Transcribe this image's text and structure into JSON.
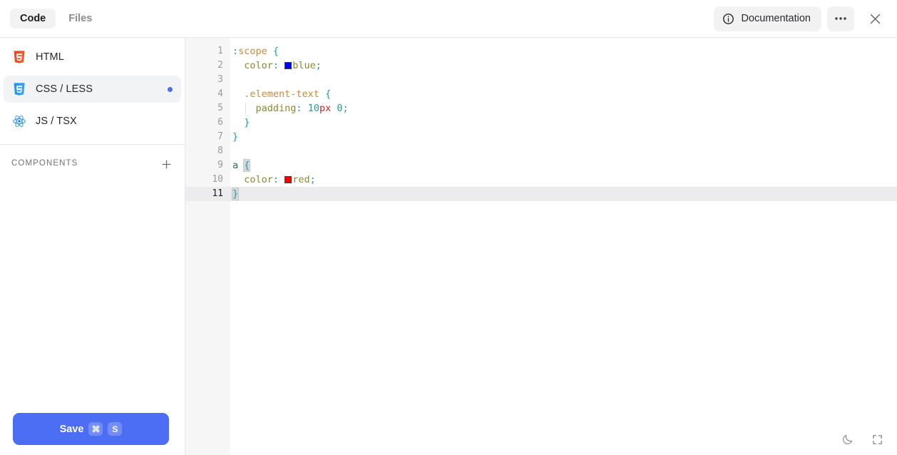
{
  "topbar": {
    "tabs": [
      {
        "label": "Code",
        "active": true
      },
      {
        "label": "Files",
        "active": false
      }
    ],
    "documentation_label": "Documentation",
    "info_icon": "info-circle-icon",
    "more_icon": "ellipsis-icon",
    "close_icon": "close-icon"
  },
  "sidebar": {
    "files": [
      {
        "label": "HTML",
        "icon": "html5-icon",
        "active": false,
        "modified": false
      },
      {
        "label": "CSS / LESS",
        "icon": "css3-icon",
        "active": true,
        "modified": true
      },
      {
        "label": "JS / TSX",
        "icon": "react-icon",
        "active": false,
        "modified": false
      }
    ],
    "components_title": "COMPONENTS",
    "add_icon": "plus-icon",
    "save": {
      "label": "Save",
      "shortcut_modifier": "⌘",
      "shortcut_key": "S"
    }
  },
  "editor": {
    "language": "css",
    "active_line": 11,
    "lines": [
      {
        "n": "1",
        "tokens": [
          {
            "t": ":",
            "c": "t-punct"
          },
          {
            "t": "scope",
            "c": "t-sel"
          },
          {
            "t": " ",
            "c": ""
          },
          {
            "t": "{",
            "c": "t-punct"
          }
        ]
      },
      {
        "n": "2",
        "indent": 0,
        "tokens": [
          {
            "t": "  ",
            "c": ""
          },
          {
            "t": "color",
            "c": "t-prop"
          },
          {
            "t": ":",
            "c": "t-punct"
          },
          {
            "t": " ",
            "c": ""
          },
          {
            "t": "#0000ff",
            "c": "swatch"
          },
          {
            "t": "blue",
            "c": "t-val"
          },
          {
            "t": ";",
            "c": "t-semi"
          }
        ]
      },
      {
        "n": "3",
        "tokens": []
      },
      {
        "n": "4",
        "tokens": [
          {
            "t": "  ",
            "c": ""
          },
          {
            "t": ".element-text",
            "c": "t-sel"
          },
          {
            "t": " ",
            "c": ""
          },
          {
            "t": "{",
            "c": "t-punct"
          }
        ]
      },
      {
        "n": "5",
        "guide": 21,
        "tokens": [
          {
            "t": "    ",
            "c": ""
          },
          {
            "t": "padding",
            "c": "t-prop"
          },
          {
            "t": ":",
            "c": "t-punct"
          },
          {
            "t": " ",
            "c": ""
          },
          {
            "t": "10",
            "c": "t-num"
          },
          {
            "t": "px",
            "c": "t-unit"
          },
          {
            "t": " ",
            "c": ""
          },
          {
            "t": "0",
            "c": "t-num"
          },
          {
            "t": ";",
            "c": "t-semi"
          }
        ]
      },
      {
        "n": "6",
        "tokens": [
          {
            "t": "  ",
            "c": ""
          },
          {
            "t": "}",
            "c": "t-punct"
          }
        ]
      },
      {
        "n": "7",
        "tokens": [
          {
            "t": "}",
            "c": "t-punct"
          }
        ]
      },
      {
        "n": "8",
        "tokens": []
      },
      {
        "n": "9",
        "tokens": [
          {
            "t": "a",
            "c": "t-tag"
          },
          {
            "t": " ",
            "c": ""
          },
          {
            "t": "{",
            "c": "t-punct bracket-hl"
          }
        ]
      },
      {
        "n": "10",
        "tokens": [
          {
            "t": "  ",
            "c": ""
          },
          {
            "t": "color",
            "c": "t-prop"
          },
          {
            "t": ":",
            "c": "t-punct"
          },
          {
            "t": " ",
            "c": ""
          },
          {
            "t": "#ff0000",
            "c": "swatch"
          },
          {
            "t": "red",
            "c": "t-val"
          },
          {
            "t": ";",
            "c": "t-semi"
          }
        ]
      },
      {
        "n": "11",
        "active": true,
        "tokens": [
          {
            "t": "}",
            "c": "t-punct bracket-hl"
          }
        ]
      }
    ],
    "footer": {
      "theme_icon": "moon-icon",
      "fullscreen_icon": "fullscreen-icon"
    }
  },
  "colors": {
    "accent": "#4c6ef5",
    "active_bg": "#f2f3f4",
    "border": "#e8e8ea",
    "gutter_bg": "#f6f6f7",
    "active_line_bg": "#ececee",
    "swatch_blue": "#0000ff",
    "swatch_red": "#ff0000"
  }
}
